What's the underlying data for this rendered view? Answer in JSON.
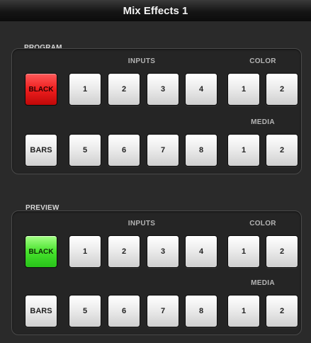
{
  "window": {
    "title": "Mix Effects 1"
  },
  "program": {
    "label": "PROGRAM",
    "inputs_label": "INPUTS",
    "color_label": "COLOR",
    "media_label": "MEDIA",
    "black_label": "BLACK",
    "bars_label": "BARS",
    "inputs_row1": [
      "1",
      "2",
      "3",
      "4"
    ],
    "inputs_row2": [
      "5",
      "6",
      "7",
      "8"
    ],
    "color": [
      "1",
      "2"
    ],
    "media": [
      "1",
      "2"
    ],
    "active": "BLACK",
    "active_color": "#e41b1b"
  },
  "preview": {
    "label": "PREVIEW",
    "inputs_label": "INPUTS",
    "color_label": "COLOR",
    "media_label": "MEDIA",
    "black_label": "BLACK",
    "bars_label": "BARS",
    "inputs_row1": [
      "1",
      "2",
      "3",
      "4"
    ],
    "inputs_row2": [
      "5",
      "6",
      "7",
      "8"
    ],
    "color": [
      "1",
      "2"
    ],
    "media": [
      "1",
      "2"
    ],
    "active": "BLACK",
    "active_color": "#3cd628"
  }
}
